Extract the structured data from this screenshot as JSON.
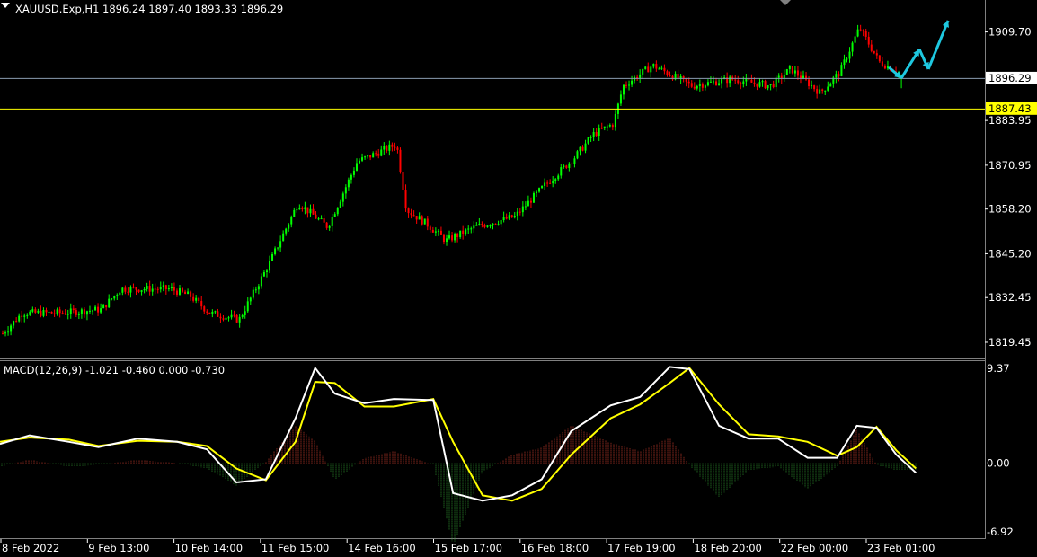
{
  "chart_header": {
    "symbol_line": "XAUUSD.Exp,H1  1896.24 1897.40 1893.33 1896.29",
    "macd_line": "MACD(12,26,9) -1.021 -0.460 0.000 -0.730"
  },
  "price_axis": {
    "ticks": [
      "1909.70",
      "1883.95",
      "1870.95",
      "1858.20",
      "1845.20",
      "1832.45",
      "1819.45"
    ],
    "tick_values": [
      1909.7,
      1883.95,
      1870.95,
      1858.2,
      1845.2,
      1832.45,
      1819.45
    ],
    "current_price_label": "1896.29",
    "current_price": 1896.29,
    "level_label": "1887.43",
    "level_price": 1887.43,
    "range": [
      1815.0,
      1919.0
    ]
  },
  "macd_axis": {
    "ticks": [
      "9.37",
      "0.00",
      "-6.92"
    ],
    "tick_values": [
      9.37,
      0.0,
      -6.92
    ]
  },
  "time_axis": {
    "labels": [
      "8 Feb 2022",
      "9 Feb 13:00",
      "10 Feb 14:00",
      "11 Feb 15:00",
      "14 Feb 16:00",
      "15 Feb 17:00",
      "16 Feb 18:00",
      "17 Feb 19:00",
      "18 Feb 20:00",
      "22 Feb 00:00",
      "23 Feb 01:00"
    ]
  },
  "colors": {
    "background": "#000000",
    "bull_candle": "#00ff00",
    "bear_candle": "#ff0000",
    "current_price_line": "#8a9bb0",
    "level_line": "#ffff00",
    "macd_line": "#ffffff",
    "signal_line": "#ffff00",
    "hist_positive": "#c0392b",
    "hist_negative": "#2e8b2e",
    "forecast_arrow": "#1ec8e0",
    "axis_text": "#ffffff"
  },
  "chart_data": [
    {
      "type": "candlestick",
      "title": "XAUUSD.Exp,H1",
      "timeframe": "H1",
      "ohlc_last": {
        "open": 1896.24,
        "high": 1897.4,
        "low": 1893.33,
        "close": 1896.29
      },
      "ylim": [
        1815.0,
        1919.0
      ],
      "close_path": {
        "x_fraction": [
          0.0,
          0.02,
          0.06,
          0.1,
          0.12,
          0.17,
          0.19,
          0.21,
          0.24,
          0.27,
          0.3,
          0.33,
          0.36,
          0.4,
          0.41,
          0.43,
          0.45,
          0.48,
          0.52,
          0.55,
          0.58,
          0.6,
          0.62,
          0.63,
          0.66,
          0.7,
          0.74,
          0.78,
          0.8,
          0.83,
          0.85,
          0.87,
          0.89,
          0.91,
          0.9125
        ],
        "close": [
          1822,
          1828,
          1828,
          1829,
          1835,
          1835,
          1833,
          1828,
          1826,
          1842,
          1860,
          1853,
          1872,
          1877,
          1858,
          1854,
          1849,
          1853,
          1856,
          1865,
          1873,
          1880,
          1883,
          1894,
          1900,
          1894,
          1896,
          1894,
          1899,
          1892,
          1898,
          1911,
          1901,
          1898,
          1896.3
        ]
      },
      "forecast_arrows": "down-up-down-up zig-zag projected to the right of the last candle"
    },
    {
      "type": "line",
      "title": "MACD(12,26,9)",
      "values_last": {
        "macd": -1.021,
        "signal": -0.46,
        "level": 0.0,
        "histogram": -0.73
      },
      "ylim": [
        -6.92,
        9.37
      ],
      "x_fraction": [
        0.0,
        0.03,
        0.07,
        0.1,
        0.14,
        0.18,
        0.21,
        0.24,
        0.27,
        0.3,
        0.32,
        0.34,
        0.37,
        0.4,
        0.44,
        0.46,
        0.49,
        0.52,
        0.55,
        0.58,
        0.62,
        0.65,
        0.68,
        0.7,
        0.73,
        0.76,
        0.79,
        0.82,
        0.85,
        0.87,
        0.89,
        0.91,
        0.93
      ],
      "series": [
        {
          "name": "MACD",
          "values": [
            1.8,
            2.6,
            2.0,
            1.5,
            2.3,
            2.0,
            1.3,
            -1.8,
            -1.5,
            4.2,
            8.9,
            6.5,
            5.6,
            6.0,
            5.9,
            -2.8,
            -3.5,
            -3.0,
            -1.5,
            3.0,
            5.4,
            6.2,
            9.0,
            8.8,
            3.5,
            2.3,
            2.3,
            0.5,
            0.5,
            3.5,
            3.3,
            0.8,
            -0.9
          ]
        },
        {
          "name": "Signal",
          "values": [
            2.0,
            2.4,
            2.2,
            1.6,
            2.1,
            2.0,
            1.6,
            -0.5,
            -1.6,
            2.0,
            7.6,
            7.5,
            5.3,
            5.3,
            6.0,
            2.0,
            -3.0,
            -3.5,
            -2.4,
            0.8,
            4.2,
            5.5,
            7.5,
            8.9,
            5.5,
            2.7,
            2.5,
            2.0,
            0.7,
            1.5,
            3.4,
            1.2,
            -0.5
          ]
        }
      ]
    }
  ]
}
